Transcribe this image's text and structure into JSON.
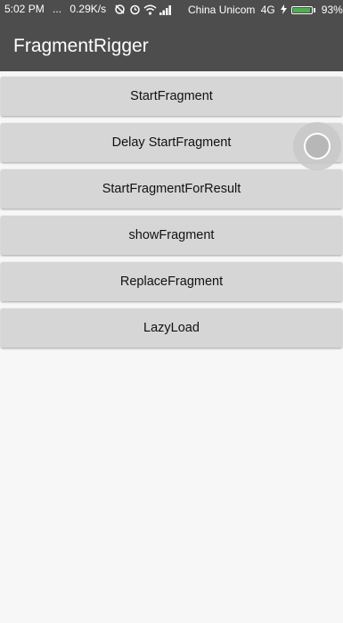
{
  "status_bar": {
    "time": "5:02 PM",
    "dots": "...",
    "speed": "0.29K/s",
    "carrier": "China Unicom",
    "network": "4G",
    "battery": "93%",
    "battery_color": "#4caf50"
  },
  "app_bar": {
    "title": "FragmentRigger",
    "background": "#4d4d4d"
  },
  "buttons": [
    {
      "label": "StartFragment"
    },
    {
      "label": "Delay StartFragment"
    },
    {
      "label": "StartFragmentForResult"
    },
    {
      "label": "showFragment"
    },
    {
      "label": "ReplaceFragment"
    },
    {
      "label": "LazyLoad"
    }
  ],
  "floating_ball": {
    "icon": "assistive-touch-icon"
  }
}
